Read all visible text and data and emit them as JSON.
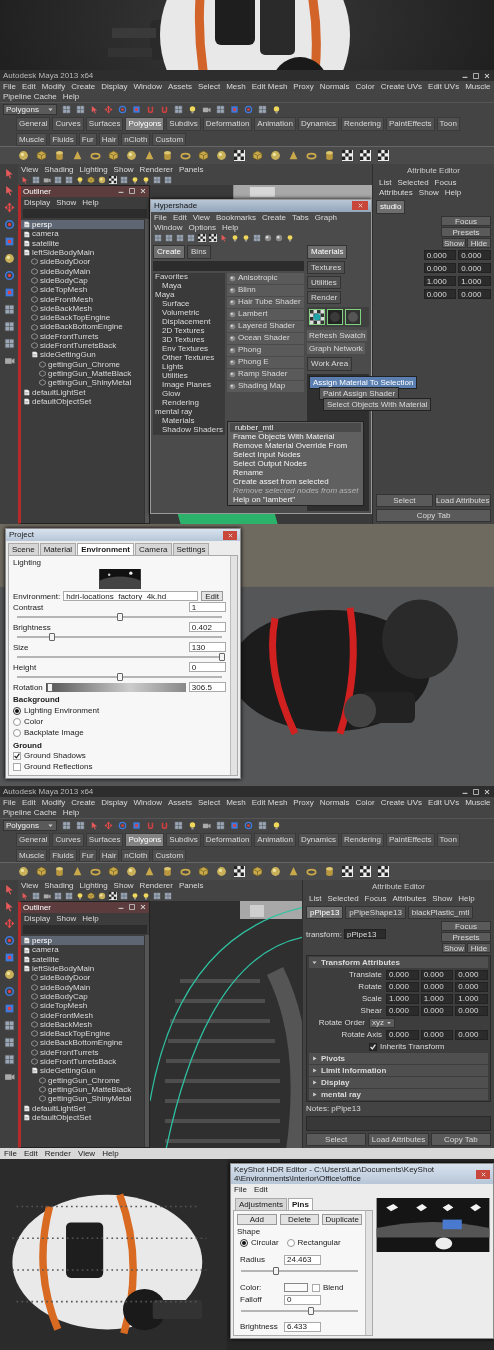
{
  "maya_screens": [
    {
      "title": "Autodesk Maya 2013 x64",
      "menu": [
        "File",
        "Edit",
        "Modify",
        "Create",
        "Display",
        "Window",
        "Assets",
        "Select",
        "Mesh",
        "Edit Mesh",
        "Proxy",
        "Normals",
        "Color",
        "Create UVs",
        "Edit UVs",
        "Muscle",
        "Pipeline Cache",
        "Help"
      ],
      "mode": "Polygons",
      "shelf_tabs": [
        {
          "label": "General",
          "selected": false
        },
        {
          "label": "Curves",
          "selected": false
        },
        {
          "label": "Surfaces",
          "selected": false
        },
        {
          "label": "Polygons",
          "selected": true
        },
        {
          "label": "Subdivs",
          "selected": false
        },
        {
          "label": "Deformation",
          "selected": false
        },
        {
          "label": "Animation",
          "selected": false
        },
        {
          "label": "Dynamics",
          "selected": false
        },
        {
          "label": "Rendering",
          "selected": false
        },
        {
          "label": "PaintEffects",
          "selected": false
        },
        {
          "label": "Toon",
          "selected": false
        },
        {
          "label": "Muscle",
          "selected": false
        },
        {
          "label": "Fluids",
          "selected": false
        },
        {
          "label": "Fur",
          "selected": false
        },
        {
          "label": "Hair",
          "selected": false
        },
        {
          "label": "nCloth",
          "selected": false
        },
        {
          "label": "Custom",
          "selected": false
        }
      ],
      "panel_menu": [
        "View",
        "Shading",
        "Lighting",
        "Show",
        "Renderer",
        "Panels"
      ],
      "viewport": {
        "kind": "shaded"
      },
      "outliner": {
        "title": "Outliner",
        "menu": [
          "Display",
          "Show",
          "Help"
        ],
        "items": [
          {
            "label": "persp",
            "selected": true
          },
          {
            "label": "camera",
            "selected": false
          },
          {
            "label": "satellite",
            "selected": false
          },
          {
            "label": "leftSideBodyMain",
            "selected": false,
            "children": [
              {
                "label": "sideBodyDoor",
                "selected": false
              },
              {
                "label": "sideBodyMain",
                "selected": false
              },
              {
                "label": "sideBodyCap",
                "selected": false
              },
              {
                "label": "sideTopMesh",
                "selected": false
              },
              {
                "label": "sideFrontMesh",
                "selected": false
              },
              {
                "label": "sideBackMesh",
                "selected": false
              },
              {
                "label": "sideBackTopEngine",
                "selected": false
              },
              {
                "label": "sideBackBottomEngine",
                "selected": false
              },
              {
                "label": "sideFrontTurrets",
                "selected": false
              },
              {
                "label": "sideFrontTurretsBack",
                "selected": false
              },
              {
                "label": "sideGettingGun",
                "selected": false,
                "children": [
                  {
                    "label": "gettingGun_Chrome",
                    "selected": false
                  },
                  {
                    "label": "gettingGun_MatteBlack",
                    "selected": false
                  },
                  {
                    "label": "gettingGun_ShinyMetal",
                    "selected": false
                  }
                ]
              }
            ]
          },
          {
            "label": "defaultLightSet",
            "selected": false
          },
          {
            "label": "defaultObjectSet",
            "selected": false
          }
        ]
      },
      "hypershade": {
        "title": "Hypershade",
        "menu": [
          "File",
          "Edit",
          "View",
          "Bookmarks",
          "Create",
          "Tabs",
          "Graph",
          "Window",
          "Options",
          "Help"
        ],
        "tabs": [
          {
            "label": "Create",
            "selected": true
          },
          {
            "label": "Bins",
            "selected": false
          }
        ],
        "categories": [
          {
            "label": "Favorites",
            "children": [
              {
                "label": "Maya"
              }
            ]
          },
          {
            "label": "Maya",
            "children": [
              {
                "label": "Surface"
              },
              {
                "label": "Volumetric"
              },
              {
                "label": "Displacement"
              },
              {
                "label": "2D Textures"
              },
              {
                "label": "3D Textures"
              },
              {
                "label": "Env Textures"
              },
              {
                "label": "Other Textures"
              },
              {
                "label": "Lights"
              },
              {
                "label": "Utilities"
              },
              {
                "label": "Image Planes"
              },
              {
                "label": "Glow"
              },
              {
                "label": "Rendering"
              }
            ]
          },
          {
            "label": "mental ray",
            "children": [
              {
                "label": "Materials"
              },
              {
                "label": "Shadow Shaders"
              }
            ]
          }
        ],
        "nodes": [
          "Anisotropic",
          "Blinn",
          "Hair Tube Shader",
          "Lambert",
          "Layered Shader",
          "Ocean Shader",
          "Phong",
          "Phong E",
          "Ramp Shader",
          "Shading Map"
        ],
        "work_tabs": [
          {
            "label": "Materials",
            "selected": true
          },
          {
            "label": "Textures",
            "selected": false
          },
          {
            "label": "Utilities",
            "selected": false
          },
          {
            "label": "Render",
            "selected": false
          }
        ],
        "swatch_labels": [
          "Refresh Swatch",
          "Graph Network"
        ],
        "work_area_tab": "Work Area",
        "marking_menu": [
          {
            "label": "Assign Material To Selection",
            "selected": true
          },
          {
            "label": "Paint Assign Shader",
            "selected": false
          },
          {
            "label": "Select Objects With Material",
            "selected": false
          }
        ],
        "context_menu": {
          "header": "rubber_mtl",
          "items": [
            {
              "label": "Frame Objects With Material",
              "disabled": false
            },
            {
              "label": "Remove Material Override From",
              "disabled": false
            },
            {
              "label": "Select Input Nodes",
              "disabled": false
            },
            {
              "label": "Select Output Nodes",
              "disabled": false
            },
            {
              "label": "Rename",
              "disabled": false
            },
            {
              "label": "Create asset from selected",
              "disabled": false
            },
            {
              "label": "Remove selected nodes from asset",
              "disabled": true
            },
            {
              "label": "Help on \"lambert\"",
              "disabled": false
            }
          ]
        }
      },
      "attribute_editor": {
        "title": "Attribute Editor",
        "menu": [
          "List",
          "Selected",
          "Focus",
          "Attributes",
          "Show",
          "Help"
        ],
        "tabs": [
          {
            "label": "studio",
            "selected": true
          }
        ],
        "side_buttons": [
          "Focus",
          "Presets",
          "Show",
          "Hide"
        ],
        "rows": [
          {
            "kind": "values",
            "label": "",
            "values": [
              "0.000",
              "0.000"
            ]
          },
          {
            "kind": "values",
            "label": "",
            "values": [
              "0.000",
              "0.000"
            ]
          },
          {
            "kind": "values",
            "label": "",
            "values": [
              "1.000",
              "1.000"
            ]
          },
          {
            "kind": "values",
            "label": "",
            "values": [
              "0.000",
              "0.000"
            ]
          }
        ],
        "bottom_buttons": [
          "Select",
          "Load Attributes",
          "Copy Tab"
        ]
      }
    },
    {
      "title": "Autodesk Maya 2013 x64",
      "menu": [
        "File",
        "Edit",
        "Modify",
        "Create",
        "Display",
        "Window",
        "Assets",
        "Select",
        "Mesh",
        "Edit Mesh",
        "Proxy",
        "Normals",
        "Color",
        "Create UVs",
        "Edit UVs",
        "Muscle",
        "Pipeline Cache",
        "Help"
      ],
      "mode": "Polygons",
      "shelf_tabs": [
        {
          "label": "General",
          "selected": false
        },
        {
          "label": "Curves",
          "selected": false
        },
        {
          "label": "Surfaces",
          "selected": false
        },
        {
          "label": "Polygons",
          "selected": true
        },
        {
          "label": "Subdivs",
          "selected": false
        },
        {
          "label": "Deformation",
          "selected": false
        },
        {
          "label": "Animation",
          "selected": false
        },
        {
          "label": "Dynamics",
          "selected": false
        },
        {
          "label": "Rendering",
          "selected": false
        },
        {
          "label": "PaintEffects",
          "selected": false
        },
        {
          "label": "Toon",
          "selected": false
        },
        {
          "label": "Muscle",
          "selected": false
        },
        {
          "label": "Fluids",
          "selected": false
        },
        {
          "label": "Fur",
          "selected": false
        },
        {
          "label": "Hair",
          "selected": false
        },
        {
          "label": "nCloth",
          "selected": false
        },
        {
          "label": "Custom",
          "selected": false
        }
      ],
      "panel_menu": [
        "View",
        "Shading",
        "Lighting",
        "Show",
        "Renderer",
        "Panels"
      ],
      "viewport": {
        "kind": "wireframe"
      },
      "outliner": {
        "title": "Outliner",
        "menu": [
          "Display",
          "Show",
          "Help"
        ],
        "items": [
          {
            "label": "persp",
            "selected": true
          },
          {
            "label": "camera",
            "selected": false
          },
          {
            "label": "satellite",
            "selected": false
          },
          {
            "label": "leftSideBodyMain",
            "selected": false,
            "children": [
              {
                "label": "sideBodyDoor",
                "selected": false
              },
              {
                "label": "sideBodyMain",
                "selected": false
              },
              {
                "label": "sideBodyCap",
                "selected": false
              },
              {
                "label": "sideTopMesh",
                "selected": false
              },
              {
                "label": "sideFrontMesh",
                "selected": false
              },
              {
                "label": "sideBackMesh",
                "selected": false
              },
              {
                "label": "sideBackTopEngine",
                "selected": false
              },
              {
                "label": "sideBackBottomEngine",
                "selected": false
              },
              {
                "label": "sideFrontTurrets",
                "selected": false
              },
              {
                "label": "sideFrontTurretsBack",
                "selected": false
              },
              {
                "label": "sideGettingGun",
                "selected": false,
                "children": [
                  {
                    "label": "gettingGun_Chrome",
                    "selected": false
                  },
                  {
                    "label": "gettingGun_MatteBlack",
                    "selected": false
                  },
                  {
                    "label": "gettingGun_ShinyMetal",
                    "selected": false
                  }
                ]
              }
            ]
          },
          {
            "label": "defaultLightSet",
            "selected": false
          },
          {
            "label": "defaultObjectSet",
            "selected": false
          }
        ]
      },
      "attribute_editor": {
        "title": "Attribute Editor",
        "menu": [
          "List",
          "Selected",
          "Focus",
          "Attributes",
          "Show",
          "Help"
        ],
        "tabs": [
          {
            "label": "pPipe13",
            "selected": true
          },
          {
            "label": "pPipeShape13",
            "selected": false
          },
          {
            "label": "blackPlastic_mtl",
            "selected": false
          }
        ],
        "node_field": {
          "label": "transform:",
          "value": "pPipe13"
        },
        "side_buttons": [
          "Focus",
          "Presets",
          "Show",
          "Hide"
        ],
        "sections": [
          {
            "label": "Transform Attributes",
            "expanded": true,
            "rows": [
              {
                "kind": "values",
                "label": "Translate",
                "values": [
                  "0.000",
                  "0.000",
                  "0.000"
                ]
              },
              {
                "kind": "values",
                "label": "Rotate",
                "values": [
                  "0.000",
                  "0.000",
                  "0.000"
                ]
              },
              {
                "kind": "values",
                "label": "Scale",
                "values": [
                  "1.000",
                  "1.000",
                  "1.000"
                ]
              },
              {
                "kind": "values",
                "label": "Shear",
                "values": [
                  "0.000",
                  "0.000",
                  "0.000"
                ]
              },
              {
                "kind": "dropdown",
                "label": "Rotate Order",
                "value": "xyz"
              },
              {
                "kind": "values",
                "label": "Rotate Axis",
                "values": [
                  "0.000",
                  "0.000",
                  "0.000"
                ]
              },
              {
                "kind": "checkbox",
                "label": "Inherits Transform",
                "checked": true
              }
            ]
          },
          {
            "label": "Pivots",
            "expanded": false
          },
          {
            "label": "Limit Information",
            "expanded": false
          },
          {
            "label": "Display",
            "expanded": false
          },
          {
            "label": "mental ray",
            "expanded": false
          }
        ],
        "notes": "Notes:  pPipe13",
        "bottom_buttons": [
          "Select",
          "Load Attributes",
          "Copy Tab"
        ]
      }
    }
  ],
  "project_panel": {
    "title": "Project",
    "tabs": [
      {
        "label": "Scene",
        "selected": false
      },
      {
        "label": "Material",
        "selected": false
      },
      {
        "label": "Environment",
        "selected": true
      },
      {
        "label": "Camera",
        "selected": false
      },
      {
        "label": "Settings",
        "selected": false
      }
    ],
    "section": "Lighting",
    "environment": {
      "label": "Environment:",
      "value": "hdri-locations_factory_4k.hd",
      "button": "Edit"
    },
    "sliders": [
      {
        "kind": "slider",
        "label": "Contrast",
        "value": "1",
        "level": 0.5
      },
      {
        "kind": "slider",
        "label": "Brightness",
        "value": "0.402",
        "level": 0.17
      },
      {
        "kind": "slider",
        "label": "Size",
        "value": "130",
        "level": 1
      },
      {
        "kind": "slider",
        "label": "Height",
        "value": "0",
        "level": 0.5
      },
      {
        "kind": "gradient",
        "label": "Rotation",
        "value": "306.5",
        "level": 0.03
      }
    ],
    "background": {
      "label": "Background",
      "options": [
        {
          "label": "Lighting Environment",
          "selected": true
        },
        {
          "label": "Color",
          "selected": false
        },
        {
          "label": "Backplate Image",
          "selected": false
        }
      ]
    },
    "ground": {
      "label": "Ground",
      "options": [
        {
          "label": "Ground Shadows",
          "checked": true
        },
        {
          "label": "Ground Reflections",
          "checked": false
        }
      ]
    }
  },
  "hdr_editor": {
    "app_menu": [
      "File",
      "Edit",
      "Render",
      "View",
      "Help"
    ],
    "title": "KeyShot HDR Editor - C:\\Users\\Lar\\Documents\\KeyShot 4\\Environments\\Interior\\Office\\office",
    "menu": [
      "File",
      "Edit"
    ],
    "tabs": [
      {
        "label": "Adjustments",
        "selected": false
      },
      {
        "label": "Pins",
        "selected": true
      }
    ],
    "buttons": [
      "Add",
      "Delete",
      "Duplicate"
    ],
    "shape": {
      "label": "Shape",
      "options": [
        {
          "label": "Circular",
          "selected": true
        },
        {
          "label": "Rectangular",
          "selected": false
        }
      ]
    },
    "radius": {
      "label": "Radius",
      "value": "24.463",
      "level": 0.3
    },
    "color": {
      "label": "Color:",
      "blend": {
        "label": "Blend",
        "checked": false
      }
    },
    "falloff": {
      "label": "Falloff",
      "value": "0",
      "level": 0.6
    },
    "brightness": {
      "label": "Brightness",
      "value": "6.433"
    }
  }
}
